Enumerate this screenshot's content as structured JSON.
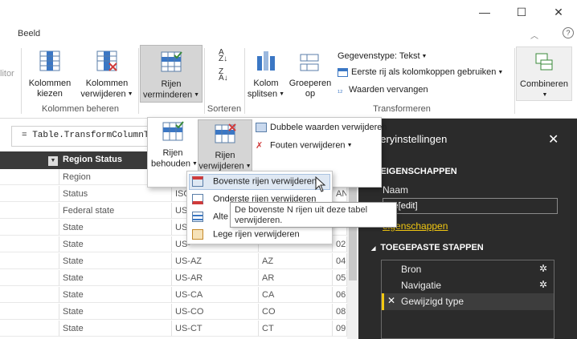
{
  "window": {
    "minimize": "—",
    "maximize": "☐",
    "close": "✕"
  },
  "menu": {
    "tab_view": "Beeld",
    "collapse": "︿",
    "help": "?"
  },
  "ribbon": {
    "cut_off_label": "litor",
    "choose_columns": [
      "Kolommen",
      "kiezen"
    ],
    "remove_columns": [
      "Kolommen",
      "verwijderen"
    ],
    "group_manage_columns": "Kolommen beheren",
    "reduce_rows": [
      "Rijen",
      "verminderen"
    ],
    "group_sort": "Sorteren",
    "split_column": [
      "Kolom",
      "splitsen"
    ],
    "group_by": [
      "Groeperen",
      "op"
    ],
    "data_type": "Gegevenstype: Tekst",
    "first_row_headers": "Eerste rij als kolomkoppen gebruiken",
    "replace_values": "Waarden vervangen",
    "group_transform": "Transformeren",
    "combine": "Combineren"
  },
  "formula": "= Table.TransformColumnT",
  "grid": {
    "header": "Region Status",
    "header_extra": "Co",
    "rows": [
      [
        "Region",
        "ISO",
        "",
        "Co"
      ],
      [
        "Status",
        "ISO",
        "",
        "AN"
      ],
      [
        "Federal state",
        "US",
        "",
        ""
      ],
      [
        "State",
        "US-",
        "",
        ""
      ],
      [
        "State",
        "US-",
        "",
        "02"
      ],
      [
        "State",
        "US-AZ",
        "AZ",
        "04"
      ],
      [
        "State",
        "US-AR",
        "AR",
        "05"
      ],
      [
        "State",
        "US-CA",
        "CA",
        "06"
      ],
      [
        "State",
        "US-CO",
        "CO",
        "08"
      ],
      [
        "State",
        "US-CT",
        "CT",
        "09"
      ]
    ]
  },
  "panel": {
    "title": "ueryinstellingen",
    "close": "✕",
    "properties": "EIGENSCHAPPEN",
    "name_label": "Naam",
    "name_value": "ble[edit]",
    "all_properties": "eigenschappen",
    "applied_steps": "TOEGEPASTE STAPPEN",
    "steps": [
      "Bron",
      "Navigatie",
      "Gewijzigd type"
    ]
  },
  "dropdown1": {
    "keep_rows": [
      "Rijen",
      "behouden"
    ],
    "remove_rows": [
      "Rijen",
      "verwijderen"
    ],
    "remove_duplicates": "Dubbele waarden verwijderen",
    "remove_errors": "Fouten verwijderen"
  },
  "dropdown2": {
    "items": [
      "Bovenste rijen verwijderen",
      "Onderste rijen verwijderen",
      "Alte",
      "Lege rijen verwijderen"
    ]
  },
  "tooltip": "De bovenste N rijen uit deze tabel verwijderen."
}
